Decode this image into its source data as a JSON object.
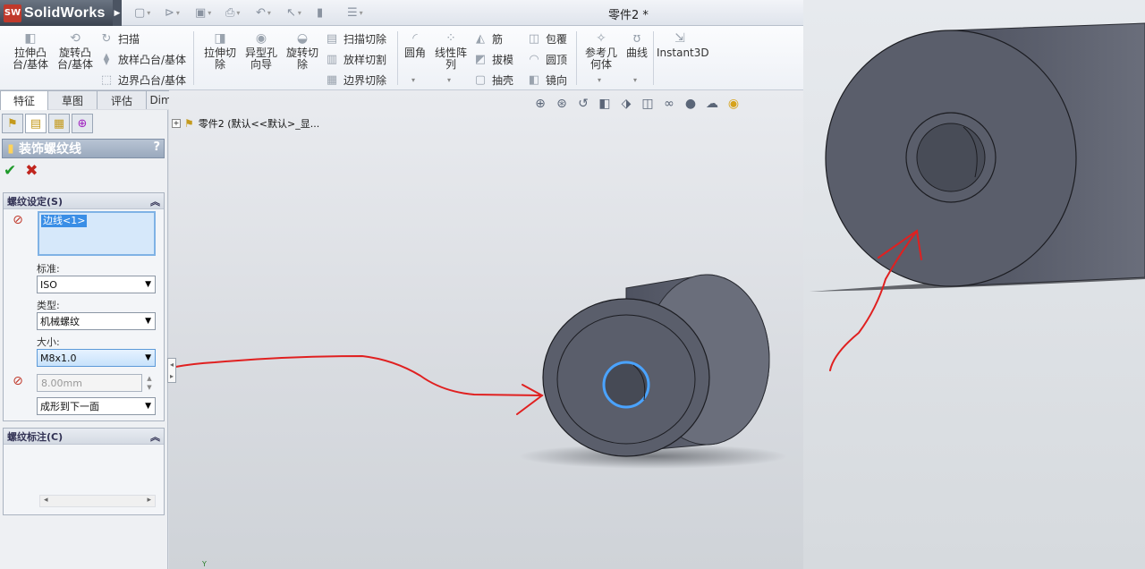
{
  "app": {
    "brand": "SolidWorks",
    "brand_badge": "SW",
    "document_title": "零件2 *"
  },
  "ribbon": {
    "big_buttons": [
      {
        "label": "拉伸凸\n台/基体"
      },
      {
        "label": "旋转凸\n台/基体"
      },
      {
        "label": "拉伸切\n除"
      },
      {
        "label": "异型孔\n向导"
      },
      {
        "label": "旋转切\n除"
      },
      {
        "label": "圆角"
      },
      {
        "label": "线性阵\n列"
      },
      {
        "label": "参考几\n何体"
      },
      {
        "label": "曲线"
      },
      {
        "label": "Instant3D"
      }
    ],
    "small_buttons": [
      {
        "label": "扫描"
      },
      {
        "label": "放样凸台/基体"
      },
      {
        "label": "边界凸台/基体"
      },
      {
        "label": "扫描切除"
      },
      {
        "label": "放样切割"
      },
      {
        "label": "边界切除"
      },
      {
        "label": "筋"
      },
      {
        "label": "拔模"
      },
      {
        "label": "抽壳"
      },
      {
        "label": "包覆"
      },
      {
        "label": "圆顶"
      },
      {
        "label": "镜向"
      }
    ]
  },
  "tabs": [
    {
      "label": "特征",
      "active": true
    },
    {
      "label": "草图",
      "active": false
    },
    {
      "label": "评估",
      "active": false
    },
    {
      "label": "DimXpert",
      "active": false
    }
  ],
  "property_manager": {
    "title": "装饰螺纹线",
    "help": "?",
    "ok": "✔",
    "cancel": "✖",
    "thread_settings": {
      "header": "螺纹设定(S)",
      "selected_edge": "边线<1>",
      "standard_label": "标准:",
      "standard_value": "ISO",
      "type_label": "类型:",
      "type_value": "机械螺纹",
      "size_label": "大小:",
      "size_value": "M8x1.0",
      "diameter_value": "8.00mm",
      "end_condition_value": "成形到下一面"
    },
    "thread_callout": {
      "header": "螺纹标注(C)"
    }
  },
  "tree": {
    "label": "零件2  (默认<<默认>_显..."
  },
  "axis_label": "Y",
  "colors": {
    "annotation_red": "#e02020",
    "selection_blue": "#4aa3ff",
    "part_gray": "#5e6270"
  }
}
